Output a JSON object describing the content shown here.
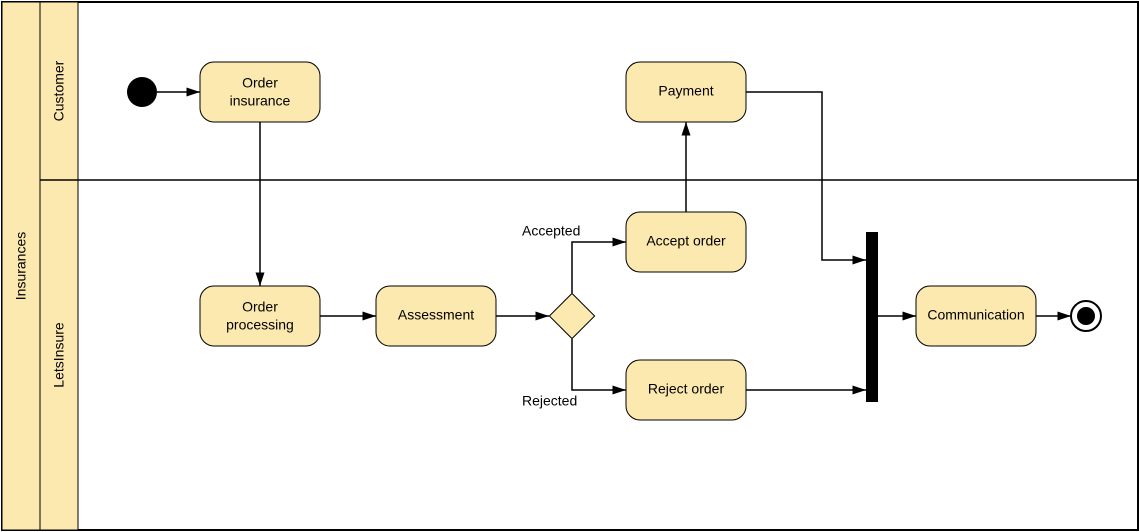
{
  "pool": {
    "title": "Insurances"
  },
  "lanes": {
    "customer": {
      "title": "Customer"
    },
    "letsinsure": {
      "title": "LetsInsure"
    }
  },
  "activities": {
    "order_insurance": {
      "line1": "Order",
      "line2": "insurance"
    },
    "payment": "Payment",
    "order_processing": {
      "line1": "Order",
      "line2": "processing"
    },
    "assessment": "Assessment",
    "accept_order": "Accept order",
    "reject_order": "Reject order",
    "communication": "Communication"
  },
  "guards": {
    "accepted": "Accepted",
    "rejected": "Rejected"
  },
  "colors": {
    "fill": "#fce9af",
    "stroke": "#000000"
  }
}
